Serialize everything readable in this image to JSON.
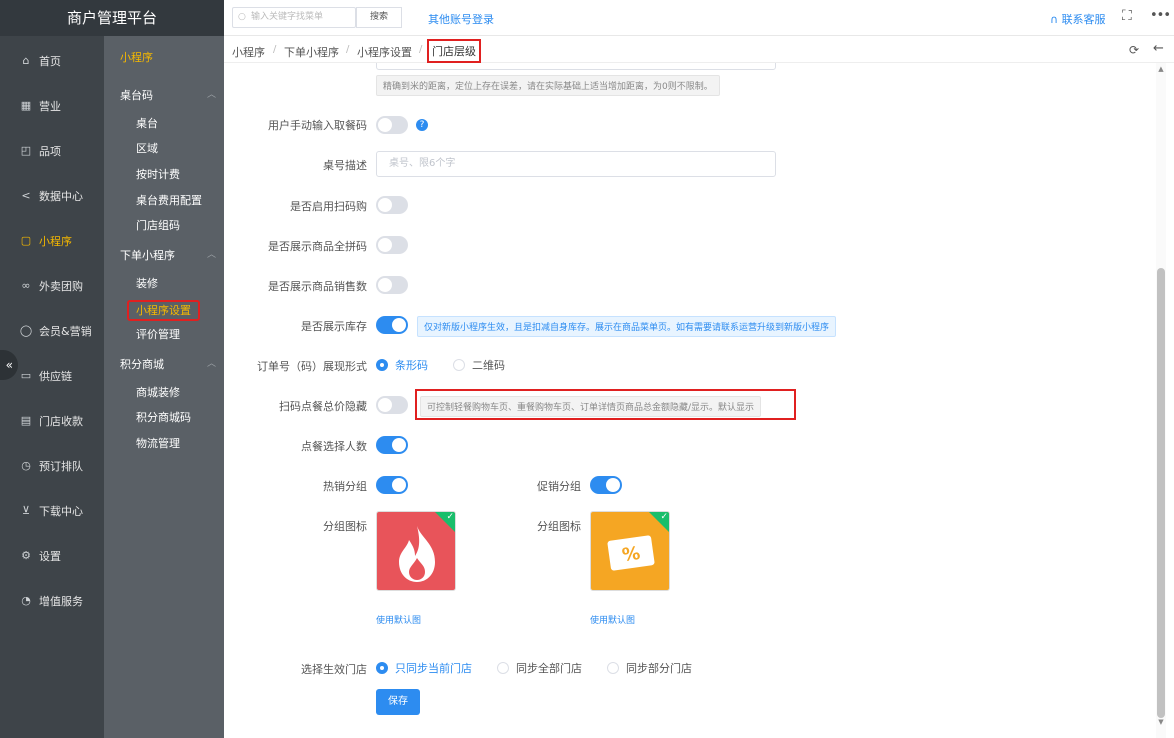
{
  "app": {
    "title": "商户管理平台"
  },
  "main_nav": [
    {
      "label": "首页",
      "icon": "home-icon",
      "glyph": "⌂"
    },
    {
      "label": "营业",
      "icon": "calendar-icon",
      "glyph": "▦"
    },
    {
      "label": "品项",
      "icon": "bag-icon",
      "glyph": "◰"
    },
    {
      "label": "数据中心",
      "icon": "share-icon",
      "glyph": "<"
    },
    {
      "label": "小程序",
      "icon": "miniapp-icon",
      "glyph": "▢"
    },
    {
      "label": "外卖团购",
      "icon": "bike-icon",
      "glyph": "∞"
    },
    {
      "label": "会员&营销",
      "icon": "user-icon",
      "glyph": "◯"
    },
    {
      "label": "供应链",
      "icon": "truck-icon",
      "glyph": "▭"
    },
    {
      "label": "门店收款",
      "icon": "wallet-icon",
      "glyph": "▤"
    },
    {
      "label": "预订排队",
      "icon": "clock-icon",
      "glyph": "◷"
    },
    {
      "label": "下载中心",
      "icon": "download-icon",
      "glyph": "⊻"
    },
    {
      "label": "设置",
      "icon": "gear-icon",
      "glyph": "⚙"
    },
    {
      "label": "增值服务",
      "icon": "alarm-icon",
      "glyph": "◔"
    }
  ],
  "sub_nav": {
    "title": "小程序",
    "groups": [
      {
        "label": "桌台码",
        "items": [
          "桌台",
          "区域",
          "按时计费",
          "桌台费用配置",
          "门店组码"
        ]
      },
      {
        "label": "下单小程序",
        "items": [
          "装修",
          "小程序设置",
          "评价管理"
        ]
      },
      {
        "label": "积分商城",
        "items": [
          "商城装修",
          "积分商城码",
          "物流管理"
        ]
      }
    ]
  },
  "topbar": {
    "search_placeholder": "输入关键字找菜单",
    "search_button": "搜索",
    "other_login": "其他账号登录",
    "service": "联系客服"
  },
  "breadcrumb": [
    "小程序",
    "下单小程序",
    "小程序设置",
    "门店层级"
  ],
  "form": {
    "distance_hint": "精确到米的距离，定位上存在误差，请在实际基础上适当增加距离，为0则不限制。",
    "manual_code": {
      "label": "用户手动输入取餐码",
      "on": false
    },
    "desk_desc": {
      "label": "桌号描述",
      "placeholder": "桌号、限6个字"
    },
    "scan_buy": {
      "label": "是否启用扫码购",
      "on": false
    },
    "pinyin": {
      "label": "是否展示商品全拼码",
      "on": false
    },
    "sales": {
      "label": "是否展示商品销售数",
      "on": false
    },
    "stock": {
      "label": "是否展示库存",
      "on": true,
      "hint": "仅对新版小程序生效，且是扣减自身库存。展示在商品菜单页。如有需要请联系运营升级到新版小程序"
    },
    "order_code": {
      "label": "订单号（码）展现形式",
      "options": [
        "条形码",
        "二维码"
      ],
      "selected": "条形码"
    },
    "hide_total": {
      "label": "扫码点餐总价隐藏",
      "on": false,
      "hint": "可控制轻餐购物车页、重餐购物车页、订单详情页商品总金额隐藏/显示。默认显示"
    },
    "people": {
      "label": "点餐选择人数",
      "on": true
    },
    "hot_group": {
      "label": "热销分组",
      "on": true
    },
    "promo_group": {
      "label": "促销分组",
      "on": true
    },
    "group_icon_label": "分组图标",
    "use_default": "使用默认图",
    "store_scope": {
      "label": "选择生效门店",
      "options": [
        "只同步当前门店",
        "同步全部门店",
        "同步部分门店"
      ],
      "selected": "只同步当前门店"
    },
    "save": "保存"
  },
  "colors": {
    "accent": "#2d8cf0",
    "nav_active": "#f5b800",
    "highlight": "#e02020",
    "hot_icon": "#e8545a",
    "promo_icon": "#f5a623"
  }
}
